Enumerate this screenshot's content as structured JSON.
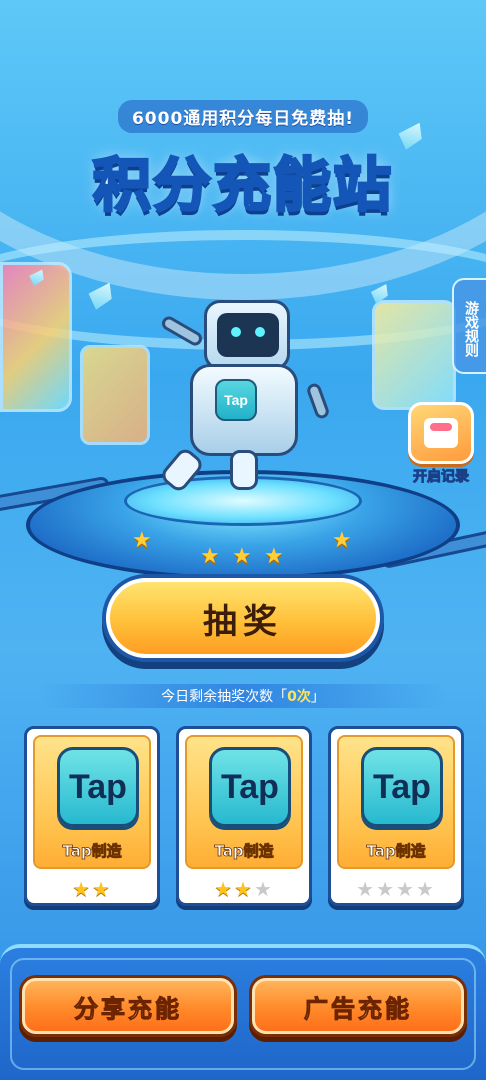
{
  "header": {
    "subtitle": "6000通用积分每日免费抽!",
    "title": "积分充能站"
  },
  "side": {
    "rules_label": "游戏规则",
    "record_label": "开启记录"
  },
  "mascot": {
    "badge_text": "Tap"
  },
  "draw": {
    "button_label": "抽奖",
    "remaining_prefix": "今日剩余抽奖次数「",
    "remaining_count": "0次",
    "remaining_suffix": "」"
  },
  "cards": [
    {
      "logo": "Tap",
      "name": "Tap制造",
      "stars_filled": 2,
      "stars_total": 2
    },
    {
      "logo": "Tap",
      "name": "Tap制造",
      "stars_filled": 2,
      "stars_total": 3
    },
    {
      "logo": "Tap",
      "name": "Tap制造",
      "stars_filled": 0,
      "stars_total": 4
    }
  ],
  "actions": {
    "share_label": "分享充能",
    "ad_label": "广告充能"
  },
  "colors": {
    "accent_orange": "#ff8a2a",
    "accent_yellow": "#ffc03a",
    "brand_blue": "#1d58a8",
    "star_on": "#ffc21f",
    "star_off": "#c9c9c9"
  }
}
